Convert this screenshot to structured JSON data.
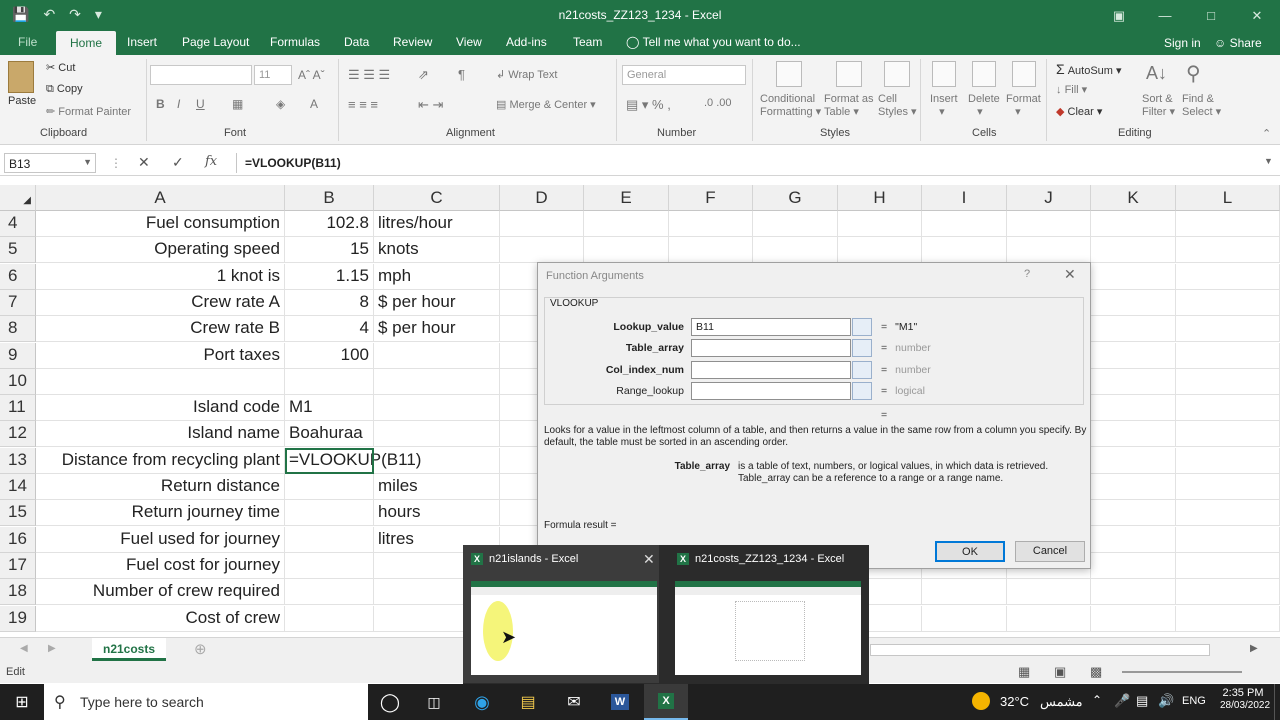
{
  "window": {
    "title": "n21costs_ZZ123_1234 - Excel",
    "sign_in": "Sign in",
    "share": "Share"
  },
  "ribbon_tabs": [
    "File",
    "Home",
    "Insert",
    "Page Layout",
    "Formulas",
    "Data",
    "Review",
    "View",
    "Add-ins",
    "Team"
  ],
  "tell_me": "Tell me what you want to do...",
  "ribbon": {
    "clipboard": {
      "paste": "Paste",
      "cut": "Cut",
      "copy": "Copy",
      "format_painter": "Format Painter",
      "label": "Clipboard"
    },
    "font": {
      "size": "11",
      "label": "Font"
    },
    "alignment": {
      "wrap_text": "Wrap Text",
      "merge_center": "Merge & Center",
      "label": "Alignment"
    },
    "number": {
      "format": "General",
      "label": "Number"
    },
    "styles": {
      "conditional": "Conditional",
      "formatting": "Formatting",
      "format_as": "Format as",
      "table": "Table",
      "cell": "Cell",
      "styles_btn": "Styles",
      "label": "Styles"
    },
    "cells": {
      "insert": "Insert",
      "delete": "Delete",
      "format": "Format",
      "label": "Cells"
    },
    "editing": {
      "autosum": "AutoSum",
      "fill": "Fill",
      "clear": "Clear",
      "sort": "Sort &",
      "filter": "Filter",
      "find": "Find &",
      "select": "Select",
      "label": "Editing"
    }
  },
  "formula_bar": {
    "name_box": "B13",
    "formula": "=VLOOKUP(B11)"
  },
  "columns": [
    "A",
    "B",
    "C",
    "D",
    "E",
    "F",
    "G",
    "H",
    "I",
    "J",
    "K",
    "L"
  ],
  "rows": [
    {
      "n": "4",
      "a": "Fuel consumption",
      "b": "102.8",
      "c": "litres/hour"
    },
    {
      "n": "5",
      "a": "Operating speed",
      "b": "15",
      "c": "knots"
    },
    {
      "n": "6",
      "a": "1 knot is",
      "b": "1.15",
      "c": "mph"
    },
    {
      "n": "7",
      "a": "Crew rate A",
      "b": "8",
      "c": "$ per hour"
    },
    {
      "n": "8",
      "a": "Crew rate B",
      "b": "4",
      "c": "$ per hour"
    },
    {
      "n": "9",
      "a": "Port taxes",
      "b": "100",
      "c": ""
    },
    {
      "n": "10",
      "a": "",
      "b": "",
      "c": ""
    },
    {
      "n": "11",
      "a": "Island code",
      "b": "M1",
      "c": ""
    },
    {
      "n": "12",
      "a": "Island name",
      "b": "Boahuraa",
      "c": ""
    },
    {
      "n": "13",
      "a": "Distance from recycling plant",
      "b": "=VLOOKUP(B11)",
      "c": ""
    },
    {
      "n": "14",
      "a": "Return distance",
      "b": "",
      "c": "miles"
    },
    {
      "n": "15",
      "a": "Return journey time",
      "b": "",
      "c": "hours"
    },
    {
      "n": "16",
      "a": "Fuel used for journey",
      "b": "",
      "c": "litres"
    },
    {
      "n": "17",
      "a": "Fuel cost for journey",
      "b": "",
      "c": ""
    },
    {
      "n": "18",
      "a": "Number of crew required",
      "b": "",
      "c": ""
    },
    {
      "n": "19",
      "a": "Cost of crew",
      "b": "",
      "c": ""
    }
  ],
  "sheet_tab": "n21costs",
  "status": "Edit",
  "dialog": {
    "title": "Function Arguments",
    "help": "?",
    "function_name": "VLOOKUP",
    "args": [
      {
        "label": "Lookup_value",
        "value": "B11",
        "result": "\"M1\""
      },
      {
        "label": "Table_array",
        "value": "",
        "result": "number"
      },
      {
        "label": "Col_index_num",
        "value": "",
        "result": "number"
      },
      {
        "label": "Range_lookup",
        "value": "",
        "result": "logical"
      }
    ],
    "equals": "=",
    "description": "Looks for a value in the leftmost column of a table, and then returns a value in the same row from a column you specify. By default, the table must be sorted in an ascending order.",
    "arg_name": "Table_array",
    "arg_desc_1": "is a table of text, numbers, or logical values, in which data is retrieved.",
    "arg_desc_2": "Table_array can be a reference to a range or a range name.",
    "formula_result": "Formula result =",
    "ok": "OK",
    "cancel": "Cancel"
  },
  "thumbnails": [
    {
      "title": "n21islands - Excel"
    },
    {
      "title": "n21costs_ZZ123_1234 - Excel"
    }
  ],
  "taskbar": {
    "search_placeholder": "Type here to search",
    "weather": "32°C",
    "weather_text": "مشمس",
    "lang": "ENG",
    "time": "2:35 PM",
    "date": "28/03/2022"
  },
  "colors": {
    "excel_green": "#217346",
    "dialog_bg": "#f0f0f0",
    "ok_border": "#0078d7"
  }
}
